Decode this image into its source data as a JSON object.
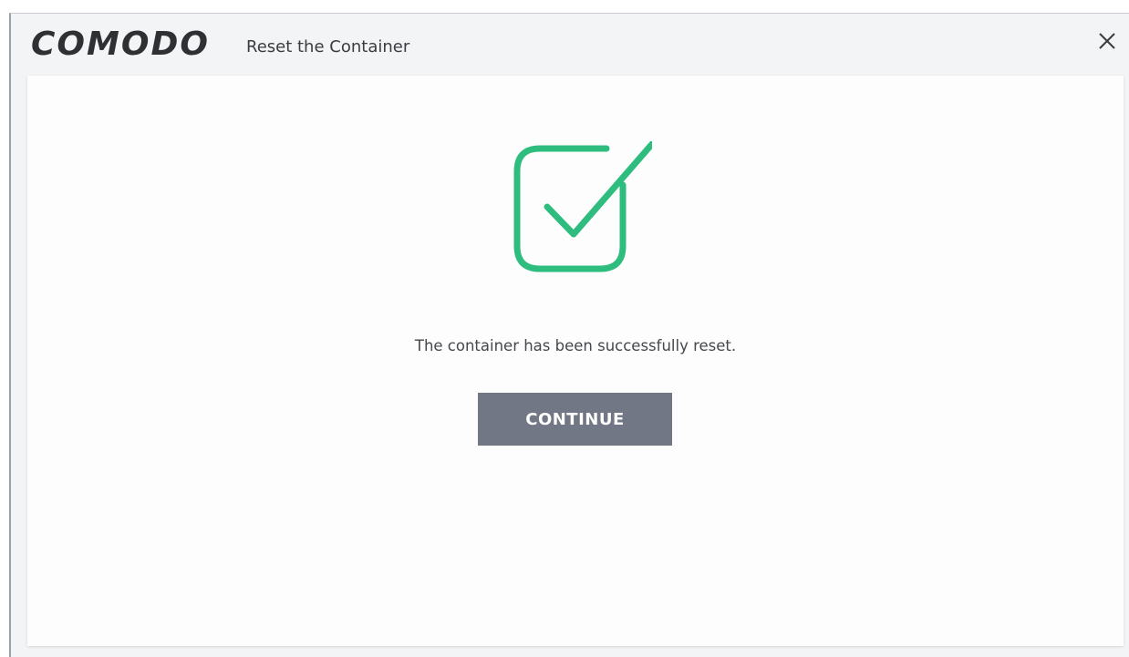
{
  "window": {
    "logo": "COMODO",
    "title": "Reset the Container",
    "close_icon": "close-icon"
  },
  "dialog": {
    "status_icon": "checkbox-checked-icon",
    "message": "The container has been successfully reset.",
    "continue_label": "CONTINUE"
  },
  "colors": {
    "accent_green": "#2ebd7f",
    "button_bg": "#717784",
    "button_text": "#ffffff",
    "text": "#45484c"
  }
}
